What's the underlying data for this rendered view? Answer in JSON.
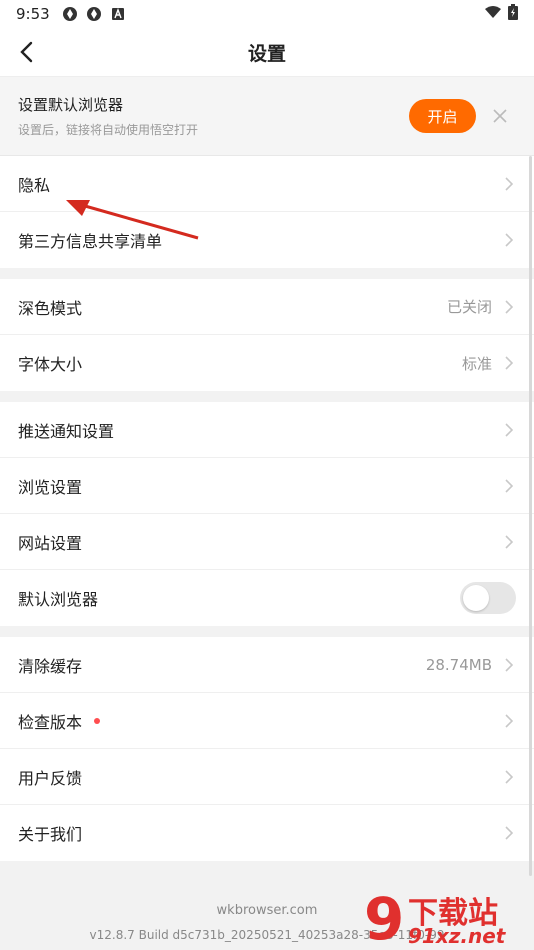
{
  "status_bar": {
    "time": "9:53"
  },
  "header": {
    "title": "设置"
  },
  "banner": {
    "title": "设置默认浏览器",
    "subtitle": "设置后，链接将自动使用悟空打开",
    "button_label": "开启"
  },
  "groups": [
    {
      "items": [
        {
          "label": "隐私"
        },
        {
          "label": "第三方信息共享清单"
        }
      ]
    },
    {
      "items": [
        {
          "label": "深色模式",
          "value": "已关闭"
        },
        {
          "label": "字体大小",
          "value": "标准"
        }
      ]
    },
    {
      "items": [
        {
          "label": "推送通知设置"
        },
        {
          "label": "浏览设置"
        },
        {
          "label": "网站设置"
        },
        {
          "label": "默认浏览器",
          "toggle": false
        }
      ]
    },
    {
      "items": [
        {
          "label": "清除缓存",
          "value": "28.74MB"
        },
        {
          "label": "检查版本",
          "badge": true
        },
        {
          "label": "用户反馈"
        },
        {
          "label": "关于我们"
        }
      ]
    }
  ],
  "footer": {
    "site": "wkbrowser.com",
    "build": "v12.8.7 Build d5c731b_20250521_40253a28-35e8-11f0-99"
  },
  "watermark": {
    "title": "下载站",
    "site": "91xz.net",
    "nine": "9"
  },
  "colors": {
    "accent": "#ff6a00",
    "badge": "#ff4d4f",
    "annotation_arrow": "#d42a1f"
  }
}
